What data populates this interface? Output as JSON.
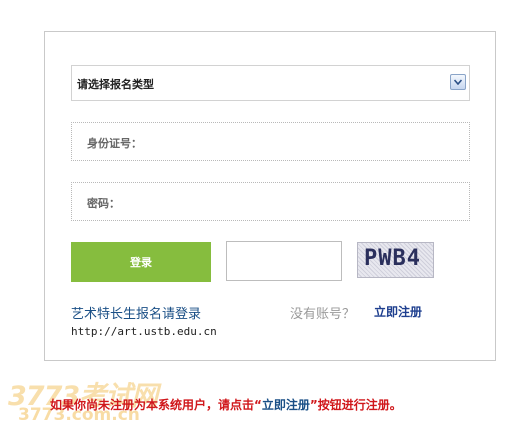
{
  "form": {
    "category_select": {
      "value": "请选择报名类型"
    },
    "id_field": {
      "label": "身份证号：",
      "value": ""
    },
    "password_field": {
      "label": "密码：",
      "value": ""
    },
    "login_button": "登录",
    "captcha_input": {
      "value": ""
    },
    "captcha_text": "PWB4"
  },
  "links": {
    "art_login": "艺术特长生报名请登录",
    "url": "http://art.ustb.edu.cn",
    "no_account": "没有账号？",
    "register": "立即注册"
  },
  "notice": {
    "prefix": "如果你尚未注册为本系统用户，请点击“",
    "link": "立即注册",
    "suffix": "”按钮进行注册。"
  },
  "watermark": {
    "line1": "3773考试网",
    "line2": "3773.com.cn"
  },
  "colors": {
    "login_button": "#86bd3e",
    "notice_red": "#d0171b",
    "link_blue": "#1e3f8f"
  }
}
